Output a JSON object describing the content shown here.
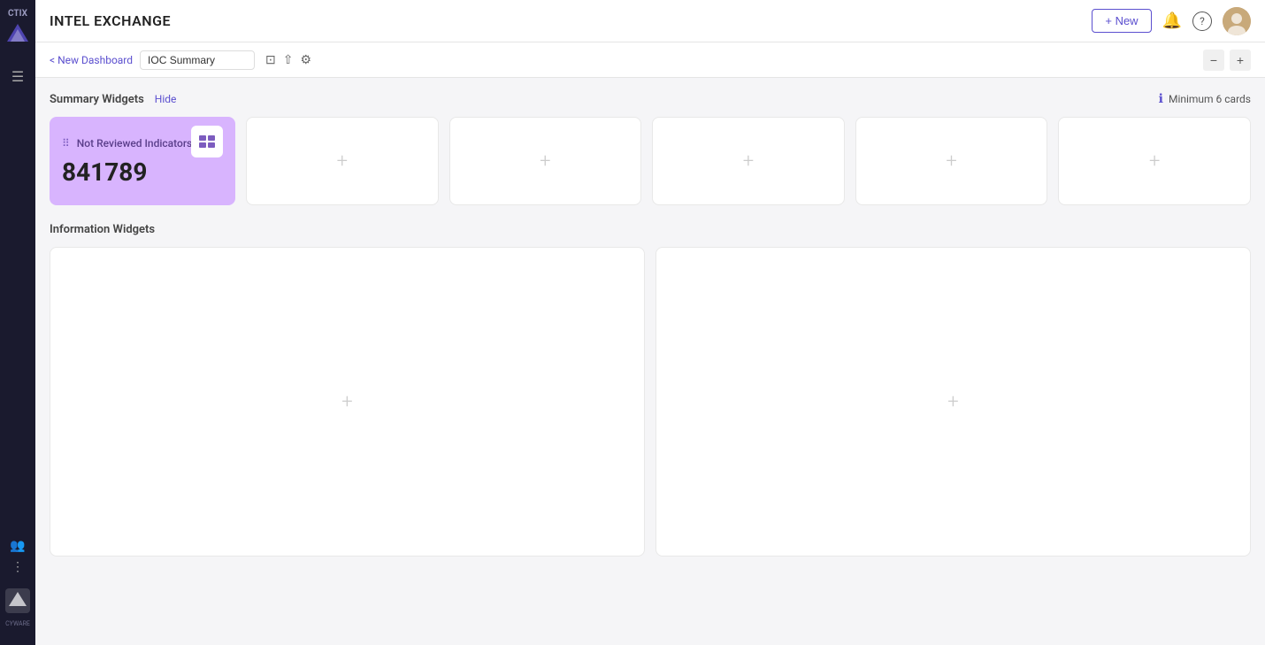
{
  "app": {
    "name": "CTIX",
    "cyware": "CYWARE"
  },
  "topbar": {
    "title": "INTEL EXCHANGE",
    "new_button_label": "+ New",
    "icons": {
      "bell": "🔔",
      "help": "?",
      "avatar": "👤"
    }
  },
  "subnav": {
    "back_label": "< New Dashboard",
    "tab_name": "IOC Summary",
    "icons": {
      "save": "⊡",
      "share": "⇧",
      "settings": "⚙"
    },
    "zoom_in": "-",
    "zoom_out": "+"
  },
  "summary_section": {
    "label": "Summary Widgets",
    "hide_label": "Hide",
    "min_cards_notice": "Minimum 6 cards"
  },
  "active_widget": {
    "drag_icon": "⠿",
    "title": "Not Reviewed Indicators",
    "menu_icon": "···",
    "value": "841789",
    "thumbnail_icon": "▦"
  },
  "empty_cards": [
    {
      "icon": "+"
    },
    {
      "icon": "+"
    },
    {
      "icon": "+"
    },
    {
      "icon": "+"
    },
    {
      "icon": "+"
    }
  ],
  "info_section": {
    "label": "Information Widgets"
  },
  "info_widgets": [
    {
      "icon": "+"
    },
    {
      "icon": "+"
    }
  ],
  "colors": {
    "brand_purple": "#5b4fcf",
    "card_bg_purple": "#d8b4fe",
    "sidebar_bg": "#1a1a2e"
  }
}
